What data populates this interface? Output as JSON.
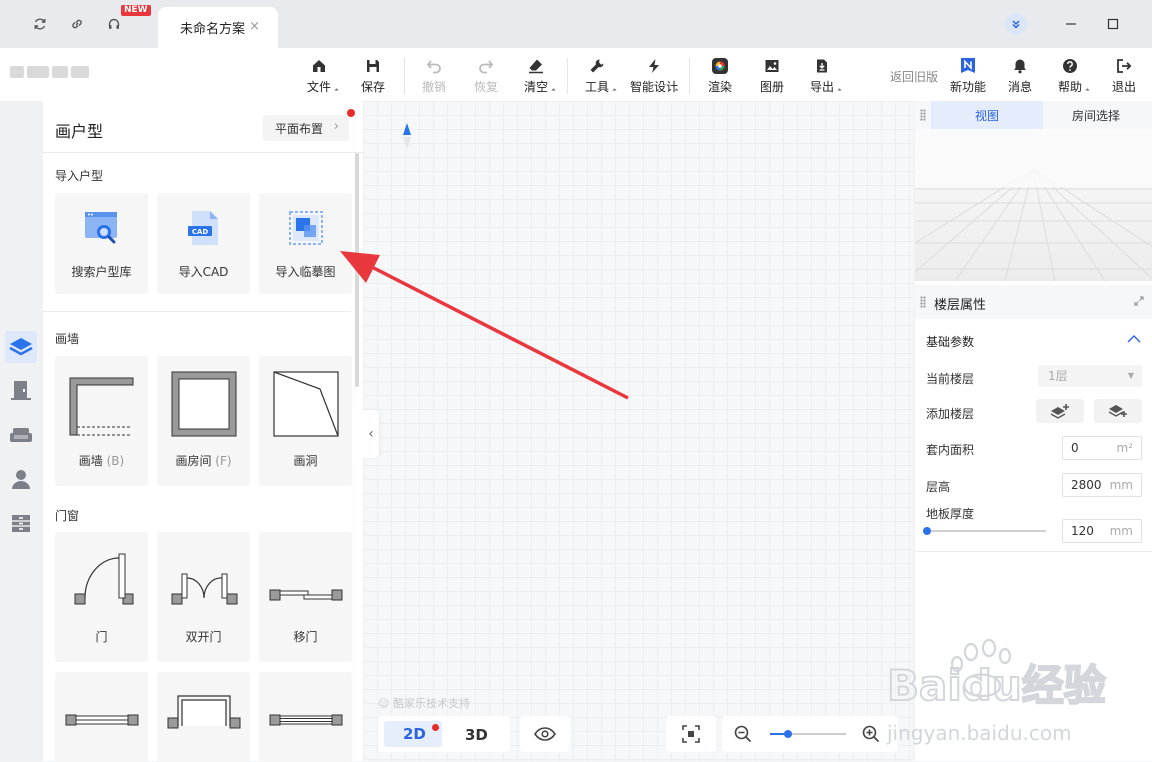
{
  "titlebar": {
    "new_badge": "NEW",
    "tab_title": "未命名方案",
    "tab_close": "×"
  },
  "toolbar": {
    "file": "文件",
    "save": "保存",
    "undo": "撤销",
    "redo": "恢复",
    "clear": "清空",
    "tools": "工具",
    "smart_design": "智能设计",
    "render": "渲染",
    "album": "图册",
    "export": "导出",
    "back_old": "返回旧版",
    "new_feature": "新功能",
    "messages": "消息",
    "help": "帮助",
    "quit": "退出"
  },
  "panel": {
    "title": "画户型",
    "plan_button": "平面布置",
    "section_import": "导入户型",
    "import_cards": [
      {
        "label": "搜索户型库"
      },
      {
        "label": "导入CAD"
      },
      {
        "label": "导入临摹图"
      }
    ],
    "cad_tag": "CAD",
    "section_wall": "画墙",
    "wall_cards": [
      {
        "label": "画墙",
        "key": "(B)"
      },
      {
        "label": "画房间",
        "key": "(F)"
      },
      {
        "label": "画洞",
        "key": ""
      }
    ],
    "section_door": "门窗",
    "door_cards": [
      {
        "label": "门"
      },
      {
        "label": "双开门"
      },
      {
        "label": "移门"
      }
    ]
  },
  "canvas": {
    "support_text": "酷家乐技术支持",
    "view_2d": "2D",
    "view_3d": "3D",
    "zoom_fraction": 0.24
  },
  "right": {
    "tab_view": "视图",
    "tab_room": "房间选择",
    "floor_props": "楼层属性",
    "basic_params": "基础参数",
    "current_floor_label": "当前楼层",
    "current_floor_value": "1层",
    "add_floor_label": "添加楼层",
    "inner_area_label": "套内面积",
    "inner_area_value": "0",
    "inner_area_unit": "m²",
    "height_label": "层高",
    "height_value": "2800",
    "height_unit": "mm",
    "thickness_label": "地板厚度",
    "thickness_value": "120",
    "thickness_unit": "mm",
    "thickness_fraction": 0.0
  },
  "watermark": {
    "brand": "Baidu经验",
    "url": "jingyan.baidu.com"
  },
  "colors": {
    "accent": "#2b63e0",
    "annotation_arrow": "#e8383d",
    "notify_dot": "#e82c2c"
  }
}
